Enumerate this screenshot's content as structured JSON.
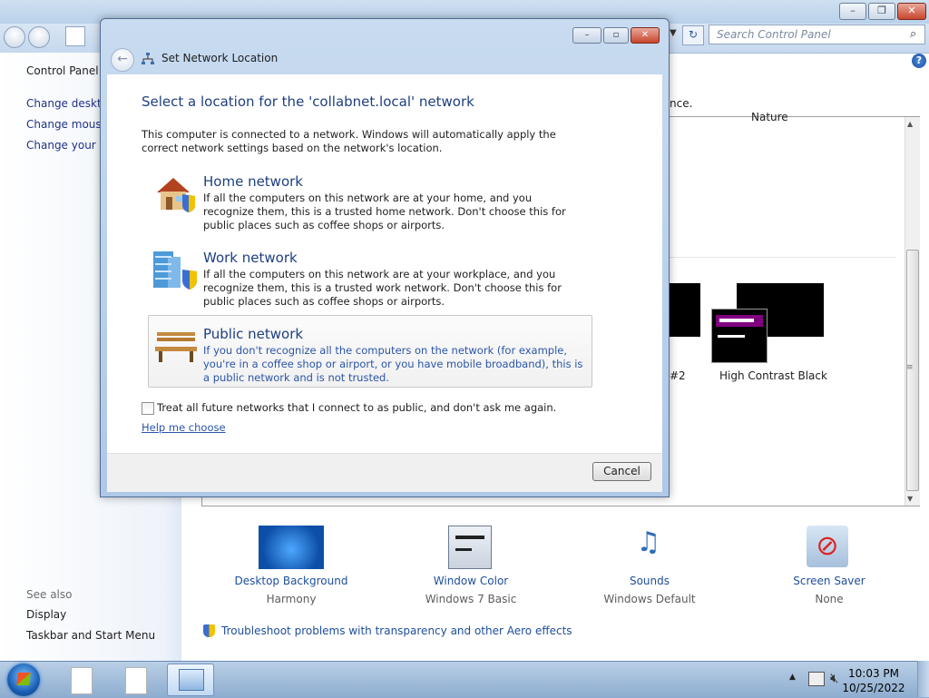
{
  "colors": {
    "link": "#1e3287",
    "heading": "#1e3f80",
    "accent_link": "#2b55a8"
  },
  "control_panel": {
    "search_placeholder": "Search Control Panel",
    "sidebar": {
      "links": [
        "Control Panel H",
        "Change desktop",
        "Change mouse",
        "Change your ac"
      ],
      "see_also": "See also",
      "bottom_links": [
        "Display",
        "Taskbar and Start Menu"
      ]
    },
    "partial_text": {
      "nce": "nce.",
      "nature": "Nature",
      "hash2": "#2"
    },
    "theme_label": "High Contrast Black",
    "bottom_items": [
      {
        "label": "Desktop Background",
        "sub": "Harmony"
      },
      {
        "label": "Window Color",
        "sub": "Windows 7 Basic"
      },
      {
        "label": "Sounds",
        "sub": "Windows Default"
      },
      {
        "label": "Screen Saver",
        "sub": "None"
      }
    ],
    "troubleshoot": "Troubleshoot problems with transparency and other Aero effects"
  },
  "dialog": {
    "title": "Set Network Location",
    "heading": "Select a location for the 'collabnet.local' network",
    "intro": "This computer is connected to a network. Windows will automatically apply the correct network settings based on the network's location.",
    "options": [
      {
        "title": "Home network",
        "desc": "If all the computers on this network are at your home, and you recognize them, this is a trusted home network.  Don't choose this for public places such as coffee shops or airports."
      },
      {
        "title": "Work network",
        "desc": "If all the computers on this network are at your workplace, and you recognize them, this is a trusted work network.  Don't choose this for public places such as coffee shops or airports."
      },
      {
        "title": "Public network",
        "desc": "If you don't recognize all the computers on the network (for example, you're in a coffee shop or airport, or you have mobile broadband), this is a public network and is not trusted."
      }
    ],
    "checkbox_label": "Treat all future networks that I connect to as public, and don't ask me again.",
    "checkbox_checked": false,
    "help_link": "Help me choose",
    "cancel": "Cancel"
  },
  "taskbar": {
    "time": "10:03 PM",
    "date": "10/25/2022"
  }
}
